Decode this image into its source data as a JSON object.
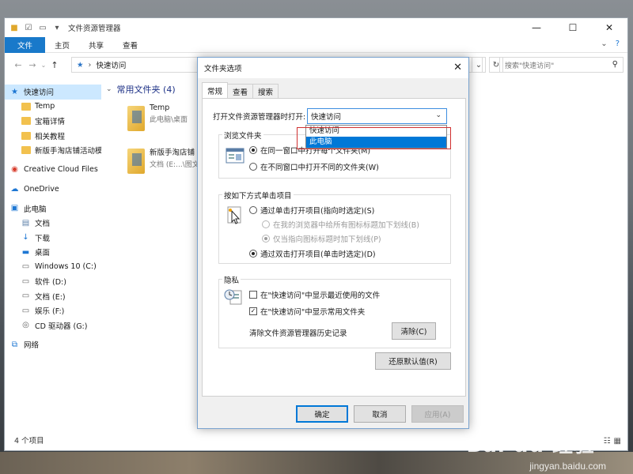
{
  "explorer": {
    "title": "文件资源管理器",
    "window_controls": {
      "minimize": "—",
      "maximize": "☐",
      "close": "✕"
    },
    "ribbon_tabs": [
      "文件",
      "主页",
      "共享",
      "查看"
    ],
    "address_path": "快速访问",
    "search_placeholder": "搜索\"快速访问\"",
    "nav": [
      {
        "label": "快速访问",
        "icon": "pin-icon"
      },
      {
        "label": "Temp",
        "icon": "folder-icon"
      },
      {
        "label": "宝箱详情",
        "icon": "folder-icon"
      },
      {
        "label": "相关教程",
        "icon": "folder-icon"
      },
      {
        "label": "新版手淘店铺活动模",
        "icon": "folder-icon"
      },
      {
        "label": "Creative Cloud Files",
        "icon": "cloud-icon"
      },
      {
        "label": "OneDrive",
        "icon": "onedrive-icon"
      },
      {
        "label": "此电脑",
        "icon": "pc-icon"
      },
      {
        "label": "文档",
        "icon": "document-icon"
      },
      {
        "label": "下载",
        "icon": "download-icon"
      },
      {
        "label": "桌面",
        "icon": "desktop-icon"
      },
      {
        "label": "Windows 10 (C:)",
        "icon": "drive-icon"
      },
      {
        "label": "软件 (D:)",
        "icon": "drive-icon"
      },
      {
        "label": "文档 (E:)",
        "icon": "drive-icon"
      },
      {
        "label": "娱乐 (F:)",
        "icon": "drive-icon"
      },
      {
        "label": "CD 驱动器 (G:)",
        "icon": "cd-icon"
      },
      {
        "label": "网络",
        "icon": "network-icon"
      }
    ],
    "group_header": "常用文件夹 (4)",
    "tiles": [
      {
        "name": "Temp",
        "sub": "此电脑\\桌面"
      },
      {
        "name": "新版手淘店铺",
        "sub": "文档 (E:...\\图文"
      }
    ],
    "status": "4 个项目"
  },
  "watermark": {
    "main": "Bai du 经验",
    "sub": "jingyan.baidu.com"
  },
  "dialog": {
    "title": "文件夹选项",
    "close": "✕",
    "tabs": [
      "常规",
      "查看",
      "搜索"
    ],
    "open_label": "打开文件资源管理器时打开:",
    "open_value": "快速访问",
    "dropdown_options": [
      "快速访问",
      "此电脑"
    ],
    "browse_group": "浏览文件夹",
    "browse_opt1": "在同一窗口中打开每个文件夹(M)",
    "browse_opt2": "在不同窗口中打开不同的文件夹(W)",
    "click_group": "按如下方式单击项目",
    "click_opt1": "通过单击打开项目(指向时选定)(S)",
    "click_sub1": "在我的浏览器中给所有图标标题加下划线(B)",
    "click_sub2": "仅当指向图标标题时加下划线(P)",
    "click_opt2": "通过双击打开项目(单击时选定)(D)",
    "privacy_group": "隐私",
    "privacy_chk1": "在\"快速访问\"中显示最近使用的文件",
    "privacy_chk2": "在\"快速访问\"中显示常用文件夹",
    "clear_label": "清除文件资源管理器历史记录",
    "clear_btn": "清除(C)",
    "restore_btn": "还原默认值(R)",
    "ok": "确定",
    "cancel": "取消",
    "apply": "应用(A)"
  }
}
